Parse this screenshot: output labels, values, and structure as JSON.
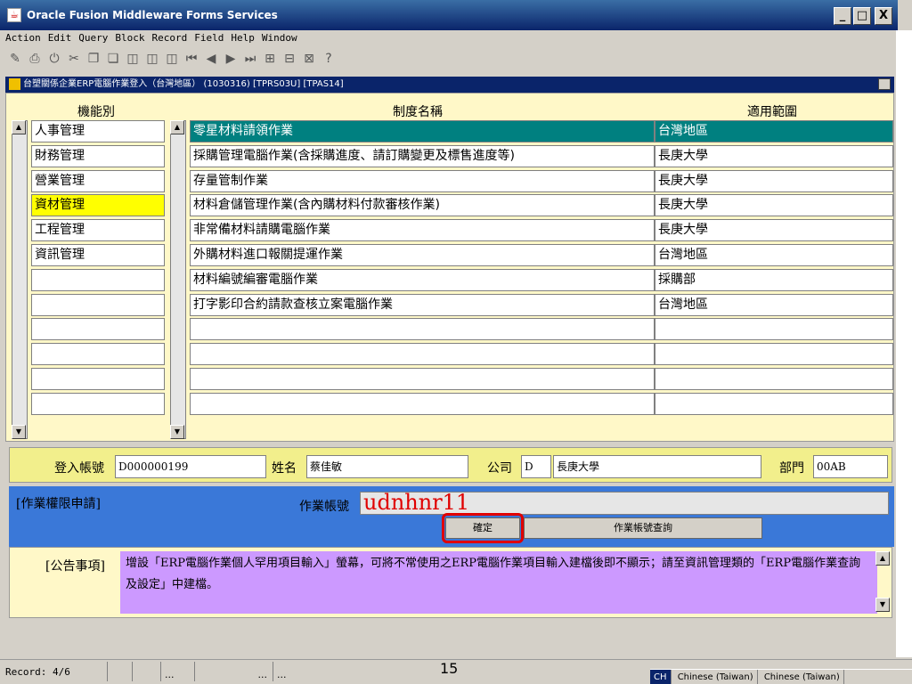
{
  "window": {
    "title": "Oracle Fusion Middleware Forms Services",
    "minimize": "_",
    "maximize": "□",
    "close": "X"
  },
  "menu": [
    "Action",
    "Edit",
    "Query",
    "Block",
    "Record",
    "Field",
    "Help",
    "Window"
  ],
  "toolbar_icons": [
    "save-icon",
    "print-icon",
    "exit-icon",
    "cut-icon",
    "copy-icon",
    "paste-icon",
    "enter-query-icon",
    "execute-query-icon",
    "cancel-query-icon",
    "first-record-icon",
    "previous-record-icon",
    "next-record-icon",
    "last-record-icon",
    "insert-record-icon",
    "delete-record-icon",
    "lock-record-icon",
    "help-icon"
  ],
  "toolbar_glyphs": [
    "✎",
    "⎙",
    "⏻",
    "✂",
    "❐",
    "❏",
    "◫",
    "◫",
    "◫",
    "⏮",
    "◀",
    "▶",
    "⏭",
    "⊞",
    "⊟",
    "⊠",
    "?"
  ],
  "form_title": "台塑關係企業ERP電腦作業登入（台灣地區） (1030316)  [TPRS03U]  [TPAS14]",
  "headers": {
    "category": "機能別",
    "system": "制度名稱",
    "scope": "適用範圍"
  },
  "categories": [
    "人事管理",
    "財務管理",
    "營業管理",
    "資材管理",
    "工程管理",
    "資訊管理",
    "",
    "",
    "",
    "",
    "",
    ""
  ],
  "selected_category_index": 3,
  "systems": [
    {
      "name": "零星材料請領作業",
      "scope": "台灣地區"
    },
    {
      "name": "採購管理電腦作業(含採購進度、請訂購變更及標售進度等)",
      "scope": "長庚大學"
    },
    {
      "name": "存量管制作業",
      "scope": "長庚大學"
    },
    {
      "name": "材料倉儲管理作業(含內購材料付款審核作業)",
      "scope": "長庚大學"
    },
    {
      "name": "非常備材料請購電腦作業",
      "scope": "長庚大學"
    },
    {
      "name": "外購材料進口報關提運作業",
      "scope": "台灣地區"
    },
    {
      "name": "材料編號編審電腦作業",
      "scope": "採購部"
    },
    {
      "name": "打字影印合約請款查核立案電腦作業",
      "scope": "台灣地區"
    },
    {
      "name": "",
      "scope": ""
    },
    {
      "name": "",
      "scope": ""
    },
    {
      "name": "",
      "scope": ""
    },
    {
      "name": "",
      "scope": ""
    }
  ],
  "selected_system_index": 0,
  "info": {
    "login_label": "登入帳號",
    "login_value": "D000000199",
    "name_label": "姓名",
    "name_value": "蔡佳敏",
    "company_label": "公司",
    "company_code": "D",
    "company_name": "長庚大學",
    "dept_label": "部門",
    "dept_value": "00AB"
  },
  "apply": {
    "title": "[作業權限申請]",
    "account_label": "作業帳號",
    "account_value": "udnhnr11",
    "ok_label": "確定",
    "query_label": "作業帳號查詢"
  },
  "notice": {
    "label": "[公告事項]",
    "text": "增設「ERP電腦作業個人罕用項目輸入」螢幕，可將不常使用之ERP電腦作業項目輸入建檔後即不顯示；請至資訊管理類的「ERP電腦作業查詢及設定」中建檔。"
  },
  "status": {
    "record": "Record: 4/6",
    "box1": "",
    "box2": "",
    "box3": "...",
    "box4": "...",
    "box5": "..."
  },
  "page_number": "15",
  "taskbar": [
    "CH",
    "Chinese (Taiwan)",
    "Chinese (Taiwan)"
  ],
  "colors": {
    "selected": "#008080",
    "highlight": "#ffff00",
    "panel": "#fff8c8",
    "blue": "#3a78d8",
    "notice": "#cc99ff",
    "ring": "#e00000"
  }
}
